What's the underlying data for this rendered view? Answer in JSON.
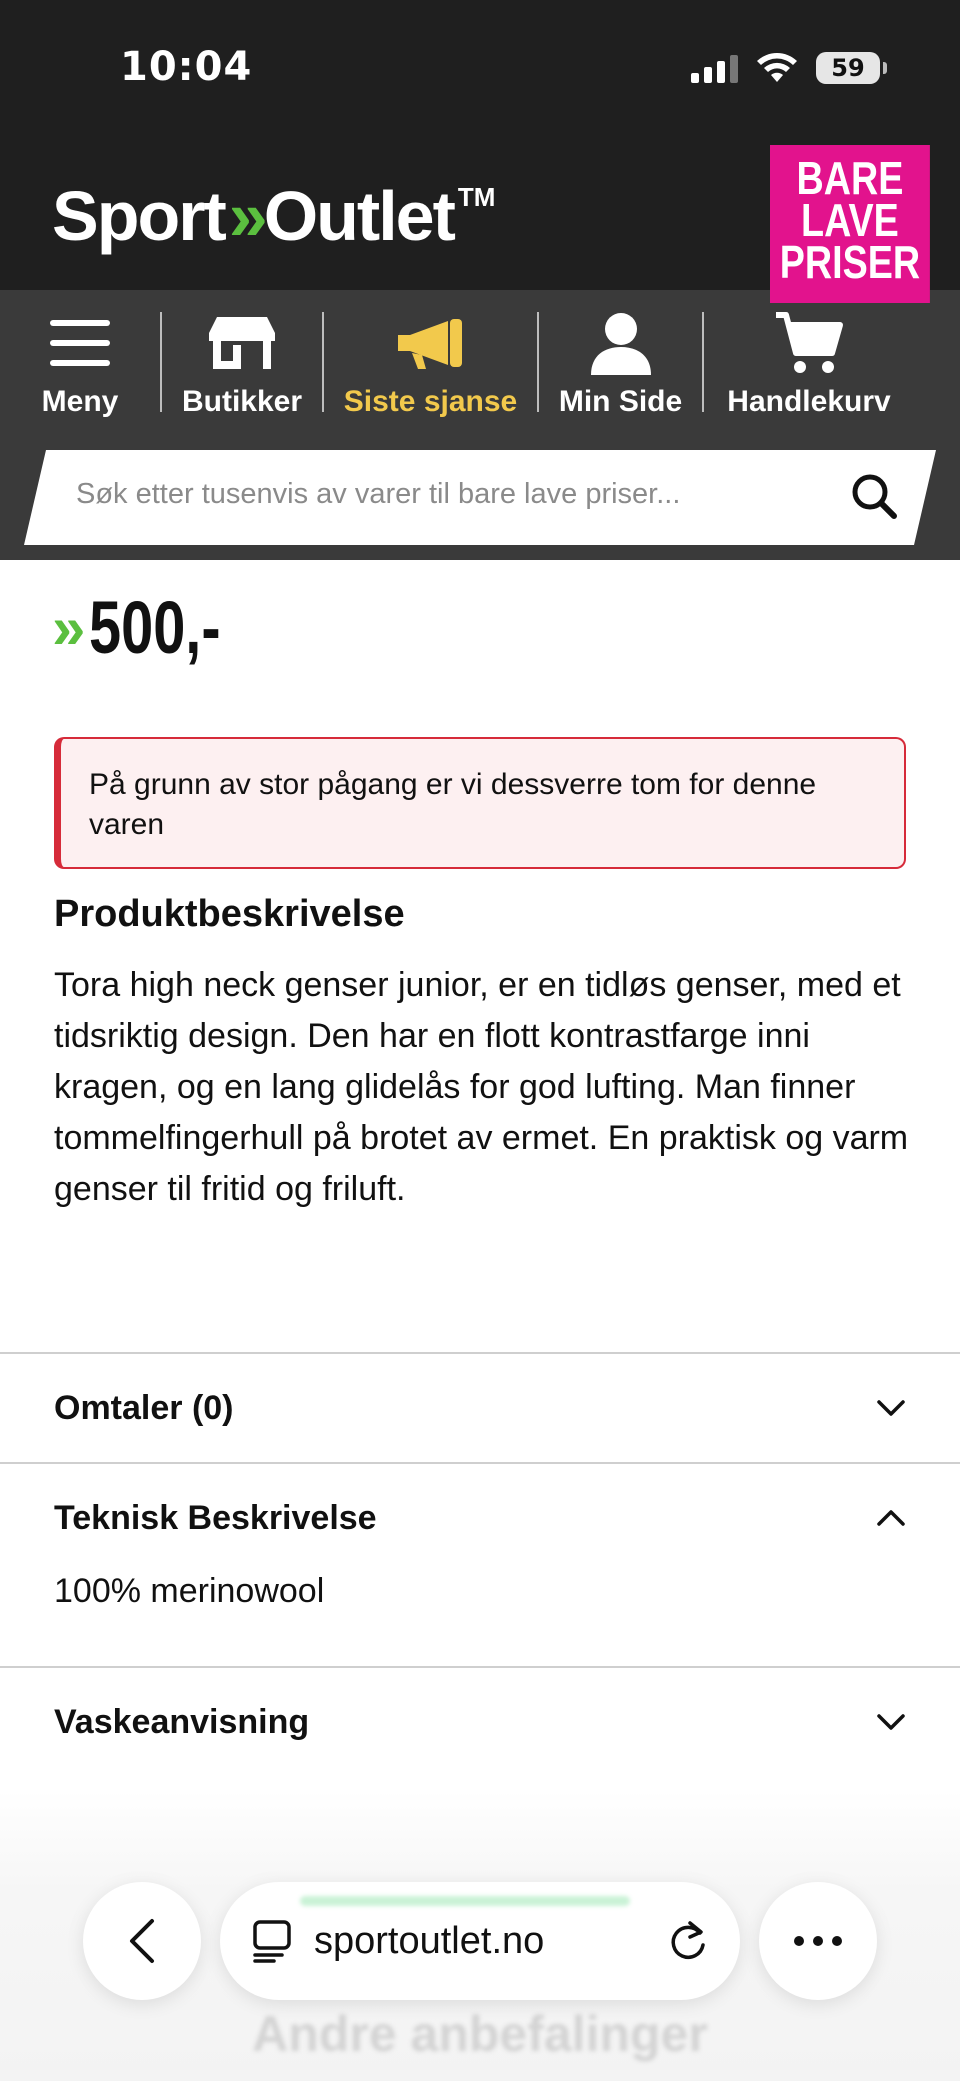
{
  "status": {
    "time": "10:04",
    "battery": "59"
  },
  "header": {
    "logo_left": "Sport",
    "logo_arrows": "»",
    "logo_right": "Outlet",
    "logo_tm": "TM",
    "promo_lines": [
      "BARE",
      "LAVE",
      "PRISER"
    ],
    "promo_color": "#e2138d"
  },
  "nav": {
    "items": [
      {
        "label": "Meny",
        "icon": "menu-icon"
      },
      {
        "label": "Butikker",
        "icon": "store-icon"
      },
      {
        "label": "Siste sjanse",
        "icon": "megaphone-icon",
        "active": true
      },
      {
        "label": "Min Side",
        "icon": "user-icon"
      },
      {
        "label": "Handlekurv",
        "icon": "cart-icon"
      }
    ],
    "active_color": "#f2c94c"
  },
  "search": {
    "placeholder": "Søk etter tusenvis av varer til bare lave priser..."
  },
  "product": {
    "price_arrows": "»",
    "price": "500,-",
    "stock_alert": "På grunn av stor pågang er vi dessverre tom for denne varen",
    "description_title": "Produktbeskrivelse",
    "description": "Tora high neck genser junior, er en tidløs genser, med et tidsriktig design. Den har en flott kontrastfarge inni kragen, og en lang glidelås for god lufting. Man finner tommelfingerhull på brotet av ermet. En praktisk og varm genser til fritid og friluft."
  },
  "accordions": {
    "reviews": {
      "title": "Omtaler (0)",
      "expanded": false
    },
    "technical": {
      "title": "Teknisk Beskrivelse",
      "expanded": true,
      "content": "100% merinowool"
    },
    "washing": {
      "title": "Vaskeanvisning",
      "expanded": false
    }
  },
  "browser": {
    "url": "sportoutlet.no"
  },
  "below_fold_heading": "Andre anbefalinger",
  "colors": {
    "brand_green": "#5bbf3f",
    "alert_red": "#d62b3a",
    "header_bg": "#1f1f1f"
  }
}
